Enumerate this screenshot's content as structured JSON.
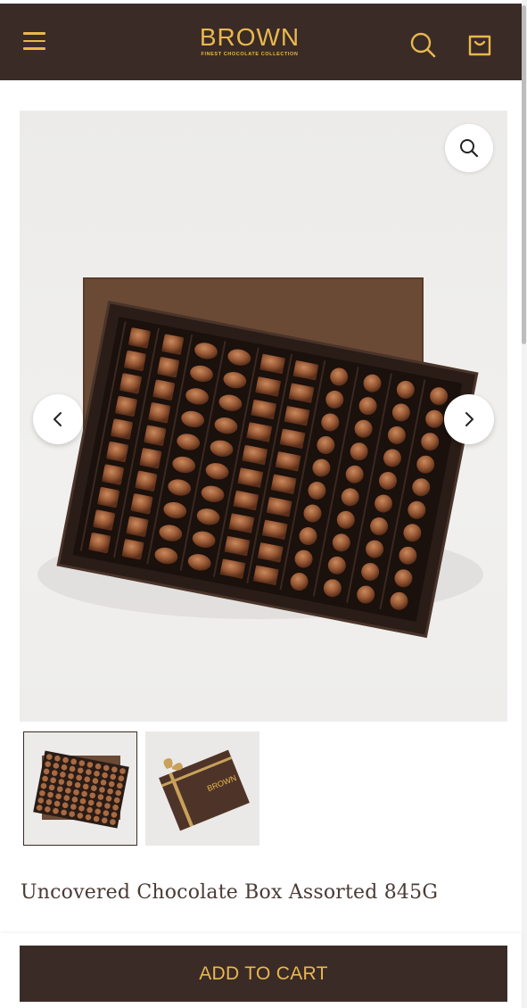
{
  "header": {
    "brand_name": "BROWN",
    "brand_tagline": "FINEST CHOCOLATE COLLECTION",
    "menu_icon": "hamburger-menu-icon",
    "search_icon": "search-icon",
    "cart_icon": "shopping-bag-icon",
    "background_color": "#3b2b26",
    "accent_color": "#e8b84f"
  },
  "gallery": {
    "zoom_icon": "zoom-icon",
    "prev_icon": "chevron-left-icon",
    "next_icon": "chevron-right-icon",
    "thumbnails": [
      {
        "label": "open box assorted chocolates",
        "selected": true
      },
      {
        "label": "closed box with ribbon",
        "selected": false,
        "box_text": "BROWN"
      }
    ]
  },
  "product": {
    "title": "Uncovered Chocolate Box Assorted 845G"
  },
  "actions": {
    "add_to_cart_label": "ADD TO CART"
  }
}
